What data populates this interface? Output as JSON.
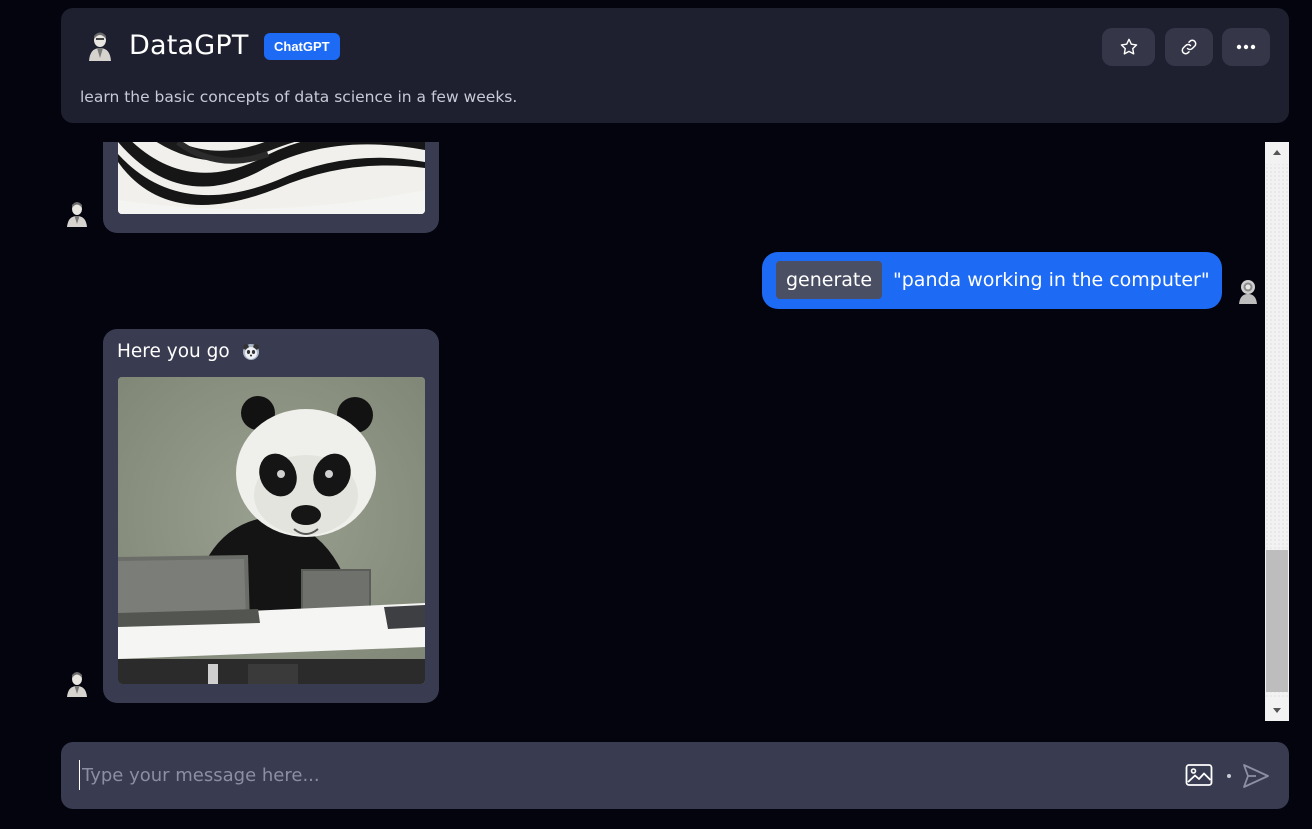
{
  "header": {
    "title": "DataGPT",
    "badge": "ChatGPT",
    "description": "learn the basic concepts of data science in a few weeks.",
    "actions": [
      {
        "icon": "star-icon",
        "label": "Favorite"
      },
      {
        "icon": "link-icon",
        "label": "Copy link"
      },
      {
        "icon": "more-icon",
        "label": "More options"
      }
    ]
  },
  "messages": [
    {
      "role": "bot",
      "type": "image",
      "content": "previous generated image (partially scrolled out)"
    },
    {
      "role": "user",
      "command": "generate",
      "text": "\"panda working in the computer\""
    },
    {
      "role": "bot",
      "text": "Here you go",
      "emoji": "panda-emoji",
      "type": "image"
    }
  ],
  "input": {
    "placeholder": "Type your message here...",
    "value": ""
  },
  "colors": {
    "background": "#03040e",
    "card": "#1e2030",
    "bubble_bot": "#393b50",
    "accent": "#1d6af5",
    "chip": "#4a4f64"
  }
}
